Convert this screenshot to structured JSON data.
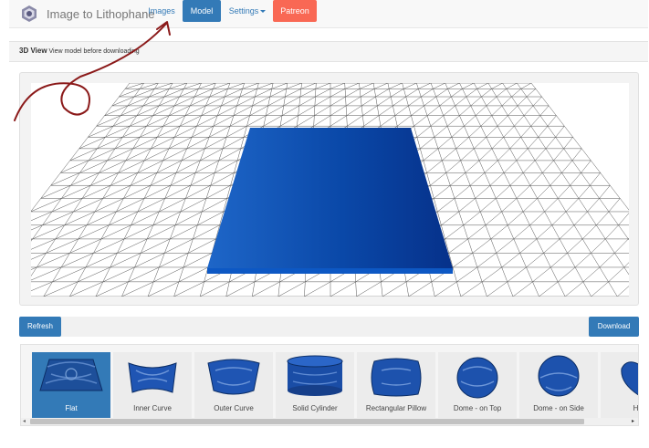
{
  "brand": {
    "name": "Image to Lithophane",
    "logo_icon": "hexagon-logo-icon"
  },
  "nav": {
    "images_label": "Images",
    "model_label": "Model",
    "settings_label": "Settings",
    "patreon_label": "Patreon"
  },
  "view": {
    "title": "3D View",
    "subtitle": "View model before downloading"
  },
  "actions": {
    "refresh_label": "Refresh",
    "download_label": "Download"
  },
  "models": [
    {
      "label": "Flat",
      "icon": "flat-model-icon",
      "selected": true
    },
    {
      "label": "Inner Curve",
      "icon": "inner-curve-model-icon",
      "selected": false
    },
    {
      "label": "Outer Curve",
      "icon": "outer-curve-model-icon",
      "selected": false
    },
    {
      "label": "Solid Cylinder",
      "icon": "solid-cylinder-model-icon",
      "selected": false
    },
    {
      "label": "Rectangular Pillow",
      "icon": "rectangular-pillow-model-icon",
      "selected": false
    },
    {
      "label": "Dome - on Top",
      "icon": "dome-on-top-model-icon",
      "selected": false
    },
    {
      "label": "Dome - on Side",
      "icon": "dome-on-side-model-icon",
      "selected": false
    },
    {
      "label": "Hea",
      "icon": "heart-model-icon",
      "selected": false
    }
  ],
  "colors": {
    "primary": "#337ab7",
    "patreon": "#f96854",
    "model_blue": "#0a48a8",
    "annotation": "#8b1a1a"
  }
}
